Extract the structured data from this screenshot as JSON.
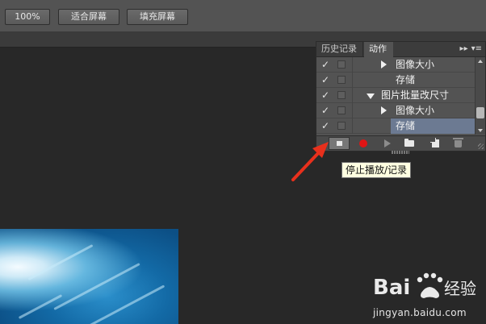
{
  "options_bar": {
    "zoom_label": "100%",
    "fit_screen_label": "适合屏幕",
    "fill_screen_label": "填充屏幕"
  },
  "panel": {
    "tabs": [
      {
        "label": "历史记录",
        "active": false
      },
      {
        "label": "动作",
        "active": true
      }
    ],
    "menu_icons": [
      "double-chevron-right-icon",
      "panel-menu-icon"
    ],
    "rows": [
      {
        "checked": true,
        "expander": "right",
        "indent": 2,
        "label": "图像大小",
        "selected": false
      },
      {
        "checked": true,
        "expander": "none",
        "indent": 2,
        "label": "存储",
        "selected": false
      },
      {
        "checked": true,
        "expander": "down",
        "indent": 1,
        "label": "图片批量改尺寸",
        "selected": false
      },
      {
        "checked": true,
        "expander": "right",
        "indent": 2,
        "label": "图像大小",
        "selected": false
      },
      {
        "checked": true,
        "expander": "none",
        "indent": 2,
        "label": "存储",
        "selected": true
      }
    ],
    "footer_buttons": [
      {
        "name": "stop-button",
        "icon": "stop-icon",
        "active": true
      },
      {
        "name": "record-button",
        "icon": "record-icon",
        "active": false
      },
      {
        "name": "play-button",
        "icon": "play-icon",
        "active": false,
        "disabled": true
      },
      {
        "name": "new-set-button",
        "icon": "folder-icon",
        "active": false
      },
      {
        "name": "new-action-button",
        "icon": "new-action-icon",
        "active": false
      },
      {
        "name": "delete-button",
        "icon": "trash-icon",
        "active": false,
        "disabled": true
      }
    ]
  },
  "tooltip": {
    "text": "停止播放/记录"
  },
  "watermark": {
    "logo_text": "Bai 经验",
    "url": "jingyan.baidu.com"
  },
  "colors": {
    "annotation_arrow": "#e8301c",
    "selected_row": "#6c7a92",
    "record_dot": "#e01515",
    "tooltip_bg": "#ffffe1"
  }
}
